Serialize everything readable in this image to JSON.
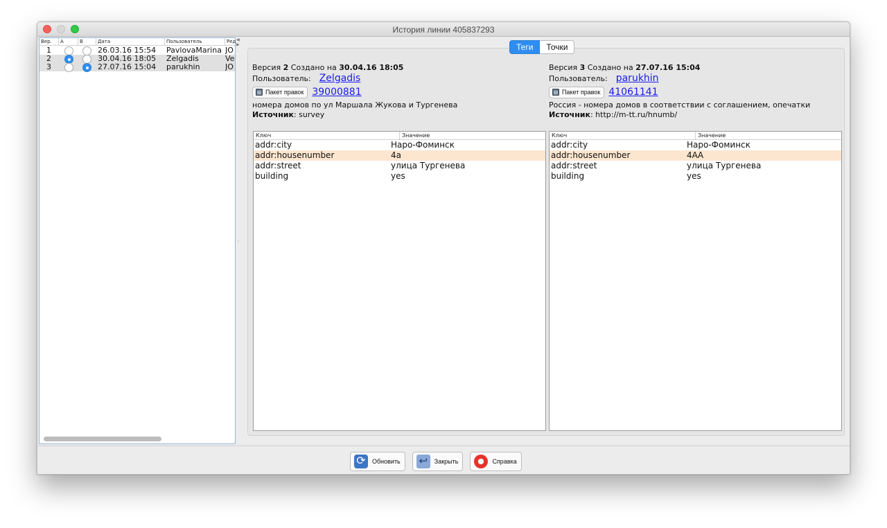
{
  "window": {
    "title": "История линии 405837293"
  },
  "history": {
    "columns": [
      "Вер.",
      "A",
      "B",
      "Дата",
      "Пользователь",
      "Ред"
    ],
    "rows": [
      {
        "ver": "1",
        "date": "26.03.16 15:54",
        "user": "PavlovaMarina",
        "editor": "JO",
        "a": false,
        "b": false,
        "selected": false
      },
      {
        "ver": "2",
        "date": "30.04.16 18:05",
        "user": "Zelgadis",
        "editor": "Ve",
        "a": true,
        "b": false,
        "selected": true
      },
      {
        "ver": "3",
        "date": "27.07.16 15:04",
        "user": "parukhin",
        "editor": "JO",
        "a": false,
        "b": true,
        "selected": true
      }
    ]
  },
  "tabs": {
    "tags": "Теги",
    "nodes": "Точки"
  },
  "left_version": {
    "version_prefix": "Версия",
    "version": "2",
    "created_label": "Создано на",
    "created": "30.04.16 18:05",
    "user_label": "Пользователь:",
    "user": "Zelgadis",
    "changeset_button": "Пакет правок",
    "changeset": "39000881",
    "comment": "номера домов по ул Маршала Жукова и Тургенева",
    "source_label": "Источник",
    "source": ": survey",
    "tags_header": {
      "key": "Ключ",
      "value": "Значение"
    },
    "tags": [
      {
        "key": "addr:city",
        "value": "Наро-Фоминск",
        "diff": false
      },
      {
        "key": "addr:housenumber",
        "value": "4а",
        "diff": true
      },
      {
        "key": "addr:street",
        "value": "улица Тургенева",
        "diff": false
      },
      {
        "key": "building",
        "value": "yes",
        "diff": false
      }
    ]
  },
  "right_version": {
    "version_prefix": "Версия",
    "version": "3",
    "created_label": "Создано на",
    "created": "27.07.16 15:04",
    "user_label": "Пользователь:",
    "user": "parukhin",
    "changeset_button": "Пакет правок",
    "changeset": "41061141",
    "comment": "Россия - номера домов в соответствии с соглашением, опечатки",
    "source_label": "Источник",
    "source": ": http://m-tt.ru/hnumb/",
    "tags_header": {
      "key": "Ключ",
      "value": "Значение"
    },
    "tags": [
      {
        "key": "addr:city",
        "value": "Наро-Фоминск",
        "diff": false
      },
      {
        "key": "addr:housenumber",
        "value": "4АА",
        "diff": true
      },
      {
        "key": "addr:street",
        "value": "улица Тургенева",
        "diff": false
      },
      {
        "key": "building",
        "value": "yes",
        "diff": false
      }
    ]
  },
  "buttons": {
    "refresh": "Обновить",
    "close": "Закрыть",
    "help": "Справка"
  },
  "colors": {
    "accent": "#2f8df2",
    "diff_highlight": "#fce6cf",
    "link": "#1a1aee"
  }
}
